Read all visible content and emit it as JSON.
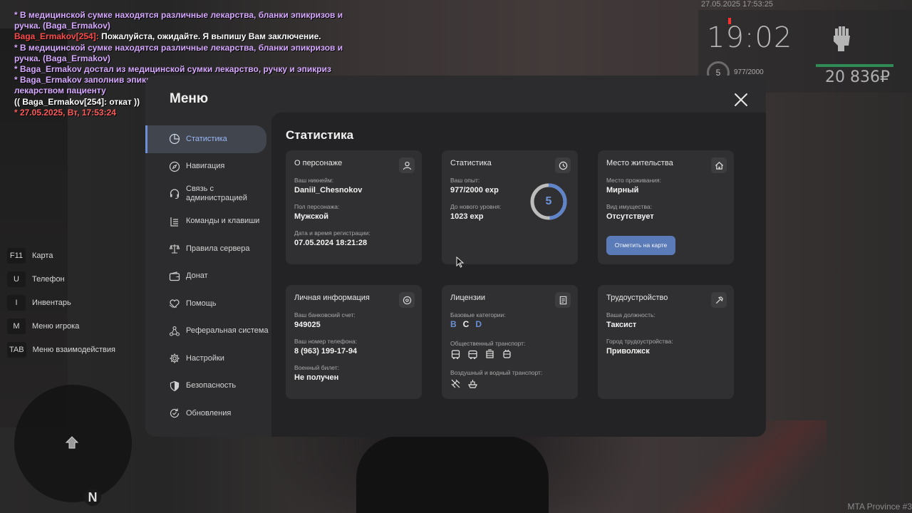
{
  "chat": [
    {
      "parts": [
        {
          "text": "* В медицинской сумке находятся различные лекарства, бланки эпикризов и ручка. (Baga_Ermakov)",
          "color": "me"
        }
      ]
    },
    {
      "parts": [
        {
          "text": "Baga_Ermakov[254]: ",
          "color": "red"
        },
        {
          "text": "Пожалуйста, ожидайте. Я выпишу Вам заключение.",
          "color": "white"
        }
      ]
    },
    {
      "parts": [
        {
          "text": "* В медицинской сумке находятся различные лекарства, бланки эпикризов и ручка. (Baga_Ermakov)",
          "color": "me"
        }
      ]
    },
    {
      "parts": [
        {
          "text": "* Baga_Ermakov достал из медицинской сумки лекарство, ручку и эпикриз",
          "color": "me"
        }
      ]
    },
    {
      "parts": [
        {
          "text": "* Baga_Ermakov заполнив эпикриз с историей болезни, передал его вместе с лекарством пациенту",
          "color": "me"
        }
      ]
    },
    {
      "parts": [
        {
          "text": "(( Baga_Ermakov[254]: откат ))",
          "color": "white"
        }
      ]
    },
    {
      "parts": [
        {
          "text": "* 27.05.2025, Вт, 17:53:24",
          "color": "date"
        }
      ]
    }
  ],
  "hud": {
    "datetime": "27.05.2025 17:53:25",
    "clock": "19:02",
    "level": "5",
    "exp": "977/2000",
    "money": "20 836₽",
    "health_color": "#2f8c56"
  },
  "hotkeys": [
    {
      "key": "F11",
      "label": "Карта"
    },
    {
      "key": "U",
      "label": "Телефон"
    },
    {
      "key": "I",
      "label": "Инвентарь"
    },
    {
      "key": "M",
      "label": "Меню игрока"
    },
    {
      "key": "TAB",
      "label": "Меню взаимодействия"
    }
  ],
  "minimap": {
    "north": "N"
  },
  "watermark": "MTA Province #3",
  "menu": {
    "title": "Меню",
    "nav": [
      {
        "label": "Статистика",
        "icon": "pie-chart-icon",
        "active": true
      },
      {
        "label": "Навигация",
        "icon": "compass-icon",
        "active": false
      },
      {
        "label": "Связь с администрацией",
        "icon": "headset-icon",
        "active": false
      },
      {
        "label": "Команды и клавиши",
        "icon": "list-icon",
        "active": false
      },
      {
        "label": "Правила сервера",
        "icon": "scales-icon",
        "active": false
      },
      {
        "label": "Донат",
        "icon": "wallet-icon",
        "active": false
      },
      {
        "label": "Помощь",
        "icon": "heart-hand-icon",
        "active": false
      },
      {
        "label": "Реферальная система",
        "icon": "network-icon",
        "active": false
      },
      {
        "label": "Настройки",
        "icon": "gear-icon",
        "active": false
      },
      {
        "label": "Безопасность",
        "icon": "shield-icon",
        "active": false
      },
      {
        "label": "Обновления",
        "icon": "refresh-icon",
        "active": false
      }
    ],
    "accent": "#6d8ed9"
  },
  "stats": {
    "title": "Статистика",
    "character": {
      "title": "О персонаже",
      "nick_label": "Ваш никнейм:",
      "nick": "Daniil_Chesnokov",
      "gender_label": "Пол персонажа:",
      "gender": "Мужской",
      "reg_label": "Дата и время регистрации:",
      "reg": "07.05.2024 18:21:28"
    },
    "statistics": {
      "title": "Статистика",
      "exp_label": "Ваш опыт:",
      "exp": "977/2000 exp",
      "next_label": "До нового уровня:",
      "next": "1023 exp",
      "level": "5",
      "level_progress": 0.4885
    },
    "residence": {
      "title": "Место жительства",
      "place_label": "Место проживания:",
      "place": "Мирный",
      "property_label": "Вид имущества:",
      "property": "Отсутствует",
      "map_button": "Отметить на карте"
    },
    "personal": {
      "title": "Личная информация",
      "bank_label": "Ваш банковский счет:",
      "bank": "949025",
      "phone_label": "Ваш номер телефона:",
      "phone": "8 (963) 199-17-94",
      "military_label": "Военный билет:",
      "military": "Не получен"
    },
    "licenses": {
      "title": "Лицензии",
      "base_label": "Базовые категории:",
      "categories": [
        {
          "name": "B",
          "owned": false
        },
        {
          "name": "C",
          "owned": true
        },
        {
          "name": "D",
          "owned": false
        }
      ],
      "public_label": "Общественный транспорт:",
      "public_icons": [
        "bus-icon",
        "bus-icon",
        "tram-icon",
        "trolleybus-icon"
      ],
      "air_label": "Воздушный и водный транспорт:",
      "air_icons": [
        "plane-icon",
        "boat-icon"
      ]
    },
    "job": {
      "title": "Трудоустройство",
      "position_label": "Ваша должность:",
      "position": "Таксист",
      "city_label": "Город трудоустройства:",
      "city": "Приволжск"
    }
  }
}
